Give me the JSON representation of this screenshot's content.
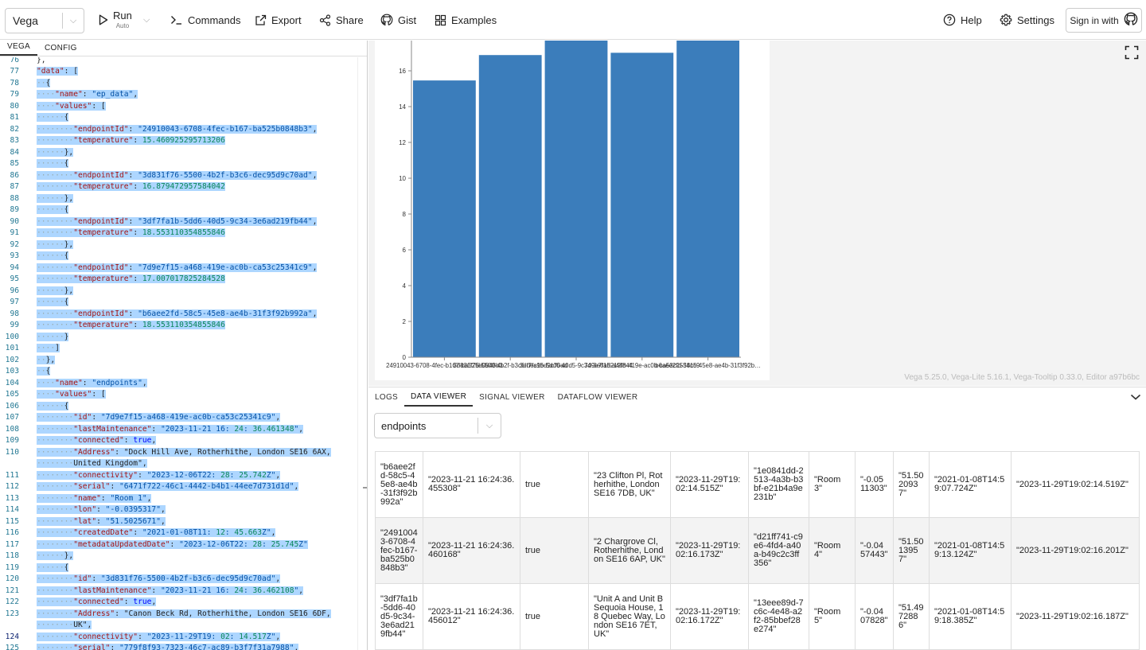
{
  "header": {
    "mode": "Vega",
    "run_label": "Run",
    "run_sub": "Auto",
    "commands_label": "Commands",
    "export_label": "Export",
    "share_label": "Share",
    "gist_label": "Gist",
    "examples_label": "Examples",
    "help_label": "Help",
    "settings_label": "Settings",
    "signin_label": "Sign in with"
  },
  "editor": {
    "tabs": [
      "VEGA",
      "CONFIG"
    ],
    "lines": [
      {
        "n": "76",
        "t": "},"
      },
      {
        "n": "77",
        "t": "\"data\": ["
      },
      {
        "n": "78",
        "t": "  {"
      },
      {
        "n": "79",
        "t": "    \"name\": \"ep_data\","
      },
      {
        "n": "80",
        "t": "    \"values\": ["
      },
      {
        "n": "81",
        "t": "      {"
      },
      {
        "n": "82",
        "t": "        \"endpointId\": \"24910043-6708-4fec-b167-ba525b0848b3\","
      },
      {
        "n": "83",
        "t": "        \"temperature\": 15.460925295713206"
      },
      {
        "n": "84",
        "t": "      },"
      },
      {
        "n": "85",
        "t": "      {"
      },
      {
        "n": "86",
        "t": "        \"endpointId\": \"3d831f76-5500-4b2f-b3c6-dec95d9c70ad\","
      },
      {
        "n": "87",
        "t": "        \"temperature\": 16.879472957584042"
      },
      {
        "n": "88",
        "t": "      },"
      },
      {
        "n": "89",
        "t": "      {"
      },
      {
        "n": "90",
        "t": "        \"endpointId\": \"3df7fa1b-5dd6-40d5-9c34-3e6ad219fb44\","
      },
      {
        "n": "91",
        "t": "        \"temperature\": 18.553110354855846"
      },
      {
        "n": "92",
        "t": "      },"
      },
      {
        "n": "93",
        "t": "      {"
      },
      {
        "n": "94",
        "t": "        \"endpointId\": \"7d9e7f15-a468-419e-ac0b-ca53c25341c9\","
      },
      {
        "n": "95",
        "t": "        \"temperature\": 17.007017825284528"
      },
      {
        "n": "96",
        "t": "      },"
      },
      {
        "n": "97",
        "t": "      {"
      },
      {
        "n": "98",
        "t": "        \"endpointId\": \"b6aee2fd-58c5-45e8-ae4b-31f3f92b992a\","
      },
      {
        "n": "99",
        "t": "        \"temperature\": 18.553110354855846"
      },
      {
        "n": "100",
        "t": "      }"
      },
      {
        "n": "101",
        "t": "    ]"
      },
      {
        "n": "102",
        "t": "  },"
      },
      {
        "n": "103",
        "t": "  {"
      },
      {
        "n": "104",
        "t": "    \"name\": \"endpoints\","
      },
      {
        "n": "105",
        "t": "    \"values\": ["
      },
      {
        "n": "106",
        "t": "      {"
      },
      {
        "n": "107",
        "t": "        \"id\": \"7d9e7f15-a468-419e-ac0b-ca53c25341c9\","
      },
      {
        "n": "108",
        "t": "        \"lastMaintenance\": \"2023-11-21 16:24:36.461348\","
      },
      {
        "n": "109",
        "t": "        \"connected\": true,"
      },
      {
        "n": "110",
        "t": "        \"Address\": \"Dock Hill Ave, Rotherhithe, London SE16 6AX,"
      },
      {
        "n": "",
        "t": "        United Kingdom\","
      },
      {
        "n": "111",
        "t": "        \"connectivity\": \"2023-12-06T22:28:25.742Z\","
      },
      {
        "n": "112",
        "t": "        \"serial\": \"6471f722-46c1-4442-b4b1-44ee7d731d1d\","
      },
      {
        "n": "113",
        "t": "        \"name\": \"Room 1\","
      },
      {
        "n": "114",
        "t": "        \"lon\": \"-0.0395317\","
      },
      {
        "n": "115",
        "t": "        \"lat\": \"51.5025671\","
      },
      {
        "n": "116",
        "t": "        \"createdDate\": \"2021-01-08T11:12:45.663Z\","
      },
      {
        "n": "117",
        "t": "        \"metadataUpdatedDate\": \"2023-12-06T22:28:25.745Z\""
      },
      {
        "n": "118",
        "t": "      },"
      },
      {
        "n": "119",
        "t": "      {"
      },
      {
        "n": "120",
        "t": "        \"id\": \"3d831f76-5500-4b2f-b3c6-dec95d9c70ad\","
      },
      {
        "n": "121",
        "t": "        \"lastMaintenance\": \"2023-11-21 16:24:36.462108\","
      },
      {
        "n": "122",
        "t": "        \"connected\": true,"
      },
      {
        "n": "123",
        "t": "        \"Address\": \"Canon Beck Rd, Rotherhithe, London SE16 6DF,"
      },
      {
        "n": "",
        "t": "        UK\","
      },
      {
        "n": "124",
        "t": "        \"connectivity\": \"2023-11-29T19:02:14.517Z\","
      },
      {
        "n": "125",
        "t": "        \"serial\": \"779f8f93-7323-46c7-ac89-b3f7f31a7988\","
      }
    ]
  },
  "chart_data": {
    "type": "bar",
    "categories": [
      "24910043-6708-4fec-b167-ba525b0848b3",
      "3d831f76-5500-4b2f-b3c6-dec95d9c70ad",
      "3df7fa1b-5dd6-40d5-9c34-3e6ad219fb44",
      "7d9e7f15-a468-419e-ac0b-ca53c25341c9",
      "b6aee2fd-58c5-45e8-ae4b-31f3f92b992a"
    ],
    "tick_labels": [
      "24910043-6708-4fec-b167-ba525b0848b3",
      "3d831f76-5500-4b2f-b3c6-dec95d9c70ad",
      "3df7fa1b-5dd6-40d5-9c34-3e6ad219fb44",
      "7d9e7f15-a468-419e-ac0b-ca53c25341c9",
      "b6aee2fd-58c5-45e8-ae4b-31f3f92b…"
    ],
    "values": [
      15.460925295713206,
      16.879472957584042,
      18.553110354855846,
      17.007017825284528,
      18.553110354855846
    ],
    "yticks": [
      0,
      2,
      4,
      6,
      8,
      10,
      12,
      14,
      16
    ],
    "ylim": [
      0,
      18
    ],
    "title": "",
    "xlabel": "",
    "ylabel": "",
    "bar_color": "#3b7dbb"
  },
  "chart": {
    "version_text": "Vega 5.25.0, Vega-Lite 5.16.1, Vega-Tooltip 0.33.0, Editor a97b6bc"
  },
  "bottom": {
    "tabs": [
      "LOGS",
      "DATA VIEWER",
      "SIGNAL VIEWER",
      "DATAFLOW VIEWER"
    ],
    "active_tab": 1,
    "dataset": "endpoints",
    "rows": [
      [
        "\"b6aee2fd-58c5-45e8-ae4b-31f3f92b992a\"",
        "\"2023-11-21 16:24:36.455308\"",
        "true",
        "\"23 Clifton Pl, Rotherhithe, London SE16 7DB, UK\"",
        "\"2023-11-29T19:02:14.515Z\"",
        "\"1e0841dd-2513-4a3b-b3bf-e21b4a9e231b\"",
        "\"Room 3\"",
        "\"-0.0511303\"",
        "\"51.5020937\"",
        "\"2021-01-08T14:59:07.724Z\"",
        "\"2023-11-29T19:02:14.519Z\""
      ],
      [
        "\"24910043-6708-4fec-b167-ba525b0848b3\"",
        "\"2023-11-21 16:24:36.460168\"",
        "true",
        "\"2 Chargrove Cl, Rotherhithe, London SE16 6AP, UK\"",
        "\"2023-11-29T19:02:16.173Z\"",
        "\"d21ff741-c9e6-4fd4-a40a-b49c2c3ff356\"",
        "\"Room 4\"",
        "\"-0.0457443\"",
        "\"51.5013957\"",
        "\"2021-01-08T14:59:13.124Z\"",
        "\"2023-11-29T19:02:16.201Z\""
      ],
      [
        "\"3df7fa1b-5dd6-40d5-9c34-3e6ad219fb44\"",
        "\"2023-11-21 16:24:36.456012\"",
        "true",
        "\"Unit A and Unit B Sequoia House, 18 Quebec Way, London SE16 7ET, UK\"",
        "\"2023-11-29T19:02:16.172Z\"",
        "\"13eee89d-7c6c-4e48-a2f2-85bbef28e274\"",
        "\"Room 5\"",
        "\"-0.0407828\"",
        "\"51.4972886\"",
        "\"2021-01-08T14:59:18.385Z\"",
        "\"2023-11-29T19:02:16.187Z\""
      ]
    ]
  }
}
